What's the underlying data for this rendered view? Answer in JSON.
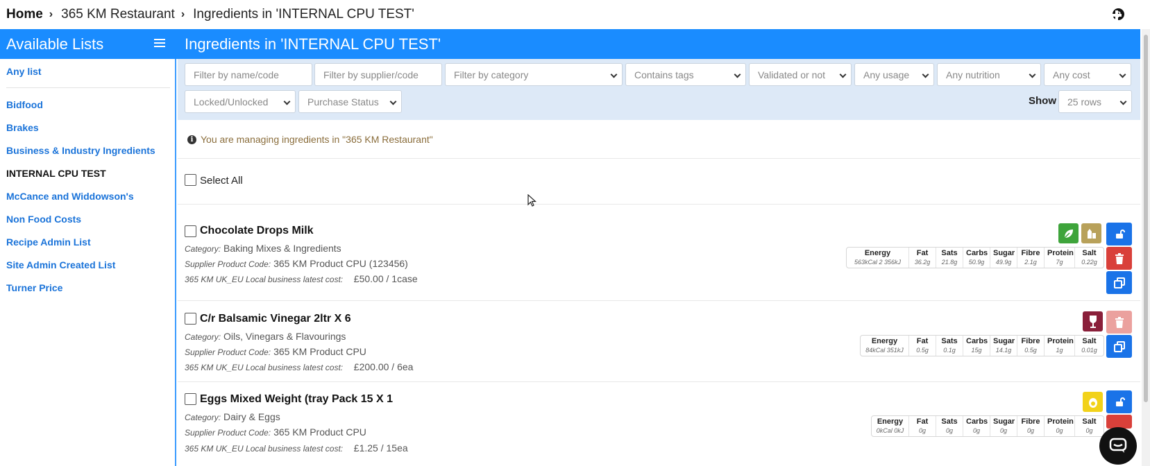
{
  "breadcrumb": {
    "home": "Home",
    "restaurant": "365 KM Restaurant",
    "current": "Ingredients in 'INTERNAL CPU TEST'"
  },
  "help_label": "?",
  "sidebar": {
    "title": "Available Lists",
    "any_list": "Any list",
    "items": [
      {
        "label": "Bidfood",
        "active": false
      },
      {
        "label": "Brakes",
        "active": false
      },
      {
        "label": "Business & Industry Ingredients",
        "active": false
      },
      {
        "label": "INTERNAL CPU TEST",
        "active": true
      },
      {
        "label": "McCance and Widdowson's",
        "active": false
      },
      {
        "label": "Non Food Costs",
        "active": false
      },
      {
        "label": "Recipe Admin List",
        "active": false
      },
      {
        "label": "Site Admin Created List",
        "active": false
      },
      {
        "label": "Turner Price",
        "active": false
      }
    ]
  },
  "header": {
    "title": "Ingredients in 'INTERNAL CPU TEST'",
    "icons": [
      "download-icon",
      "upload-icon",
      "sync-icon",
      "plus-icon"
    ]
  },
  "filters": {
    "name_placeholder": "Filter by name/code",
    "supplier_placeholder": "Filter by supplier/code",
    "category": "Filter by category",
    "tags": "Contains tags",
    "validated": "Validated or not",
    "usage": "Any usage",
    "nutrition": "Any nutrition",
    "cost": "Any cost",
    "locked": "Locked/Unlocked",
    "purchase": "Purchase Status",
    "show_label": "Show",
    "rows": "25 rows"
  },
  "info_text": "You are managing ingredients in \"365 KM Restaurant\"",
  "select_all": "Select All",
  "labels": {
    "category": "Category:",
    "supplier_code": "Supplier Product Code:",
    "cost": "365 KM UK_EU Local business latest cost:"
  },
  "nutrition_headers": [
    "Energy",
    "Fat",
    "Sats",
    "Carbs",
    "Sugar",
    "Fibre",
    "Protein",
    "Salt"
  ],
  "ingredients": [
    {
      "name": "Chocolate Drops Milk",
      "category": "Baking Mixes & Ingredients",
      "supplier_code": "365 KM Product CPU (123456)",
      "cost": "£50.00 / 1case",
      "nutrition": [
        "563kCal   2 356kJ",
        "36.2g",
        "21.8g",
        "50.9g",
        "49.9g",
        "2.1g",
        "7g",
        "0.22g"
      ],
      "tags": [
        {
          "icon": "leaf-icon",
          "color": "#3ea43b"
        },
        {
          "icon": "allergen-milk-icon",
          "color": "#b8a15a"
        }
      ],
      "locked": false
    },
    {
      "name": "C/r Balsamic Vinegar 2ltr X 6",
      "category": "Oils, Vinegars & Flavourings",
      "supplier_code": "365 KM Product CPU",
      "cost": "£200.00 / 6ea",
      "nutrition": [
        "84kCal   351kJ",
        "0.5g",
        "0.1g",
        "15g",
        "14.1g",
        "0.5g",
        "1g",
        "0.01g"
      ],
      "tags": [
        {
          "icon": "wine-glass-icon",
          "color": "#8a1f3a"
        }
      ],
      "locked": true
    },
    {
      "name": "Eggs Mixed Weight (tray Pack 15 X 1",
      "category": "Dairy & Eggs",
      "supplier_code": "365 KM Product CPU",
      "cost": "£1.25 / 15ea",
      "nutrition": [
        "0kCal   0kJ",
        "0g",
        "0g",
        "0g",
        "0g",
        "0g",
        "0g",
        "0g"
      ],
      "tags": [
        {
          "icon": "egg-icon",
          "color": "#f2d21a"
        }
      ],
      "locked": false
    }
  ]
}
